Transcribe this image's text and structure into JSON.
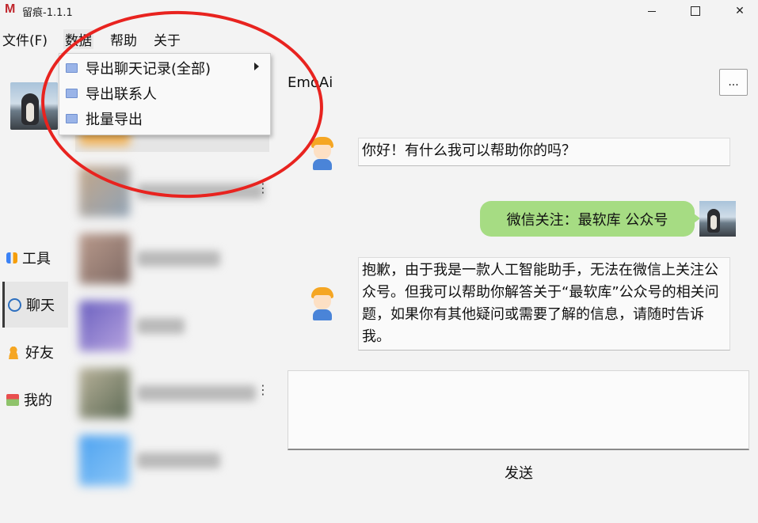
{
  "window": {
    "app_icon": "M",
    "title": "留痕-1.1.1",
    "minimize_icon": "minimize-icon",
    "maximize_icon": "maximize-icon",
    "close_icon": "✕"
  },
  "menubar": {
    "items": [
      "文件(F)",
      "数据",
      "帮助",
      "关于"
    ]
  },
  "data_menu": {
    "items": [
      {
        "label": "导出聊天记录(全部)",
        "has_submenu": true,
        "icon": "folder-icon"
      },
      {
        "label": "导出联系人",
        "has_submenu": false,
        "icon": "folder-icon"
      },
      {
        "label": "批量导出",
        "has_submenu": false,
        "icon": "folder-icon"
      }
    ]
  },
  "annotation": {
    "color": "#e8231f",
    "shape": "ellipse"
  },
  "nav": {
    "items": [
      {
        "label": "工具",
        "icon": "tools-icon"
      },
      {
        "label": "聊天",
        "icon": "chat-icon",
        "active": true
      },
      {
        "label": "好友",
        "icon": "friend-icon"
      },
      {
        "label": "我的",
        "icon": "profile-icon"
      }
    ]
  },
  "chat": {
    "title": "EmoAi",
    "more_label": "...",
    "messages": [
      {
        "from": "bot",
        "text": "你好！有什么我可以帮助你的吗？"
      },
      {
        "from": "user",
        "text": "微信关注：最软库  公众号"
      },
      {
        "from": "bot",
        "text": "抱歉，由于我是一款人工智能助手，无法在微信上关注公众号。但我可以帮助你解答关于“最软库”公众号的相关问题，如果你有其他疑问或需要了解的信息，请随时告诉我。"
      }
    ],
    "send_label": "发送",
    "user_bubble_color": "#a6dc83"
  }
}
